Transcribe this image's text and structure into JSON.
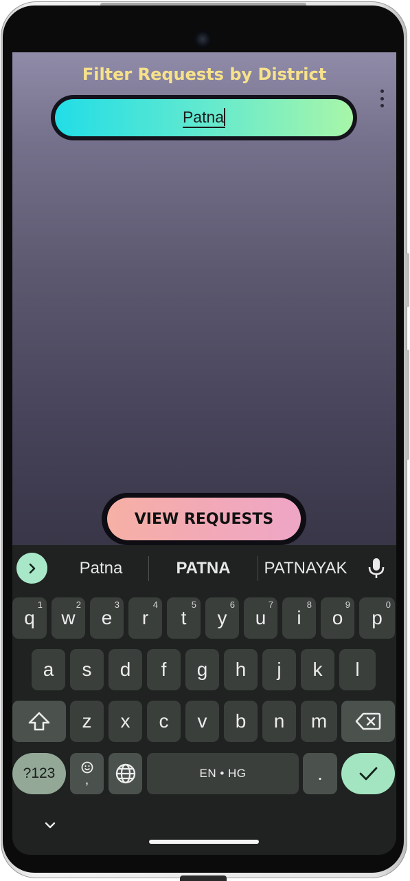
{
  "app": {
    "title": "Filter Requests by District",
    "search": {
      "value": "Patna"
    },
    "view_button_label": "VIEW REQUESTS",
    "overflow_menu_icon": "more-vert-icon"
  },
  "keyboard": {
    "suggestions": [
      "Patna",
      "PATNA",
      "PATNAYAK"
    ],
    "row1": [
      {
        "key": "q",
        "hint": "1"
      },
      {
        "key": "w",
        "hint": "2"
      },
      {
        "key": "e",
        "hint": "3"
      },
      {
        "key": "r",
        "hint": "4"
      },
      {
        "key": "t",
        "hint": "5"
      },
      {
        "key": "y",
        "hint": "6"
      },
      {
        "key": "u",
        "hint": "7"
      },
      {
        "key": "i",
        "hint": "8"
      },
      {
        "key": "o",
        "hint": "9"
      },
      {
        "key": "p",
        "hint": "0"
      }
    ],
    "row2": [
      "a",
      "s",
      "d",
      "f",
      "g",
      "h",
      "j",
      "k",
      "l"
    ],
    "row3": [
      "z",
      "x",
      "c",
      "v",
      "b",
      "n",
      "m"
    ],
    "symbols_label": "?123",
    "emoji_key_secondary": ",",
    "space_label": "EN • HG",
    "period_label": ".",
    "icons": {
      "expand": "chevron-right-icon",
      "mic": "mic-icon",
      "shift": "shift-icon",
      "backspace": "backspace-icon",
      "emoji": "emoji-icon",
      "language": "globe-icon",
      "enter": "check-icon",
      "collapse": "chevron-down-icon"
    }
  },
  "colors": {
    "title": "#f7e28a",
    "search_gradient": [
      "#22dde6",
      "#a8f6a8"
    ],
    "button_gradient": [
      "#f6b0a4",
      "#eea6c6"
    ],
    "keyboard_bg": "#1f2220",
    "key_bg": "#3b3f3c",
    "accent_key": "#a3e5c0"
  }
}
